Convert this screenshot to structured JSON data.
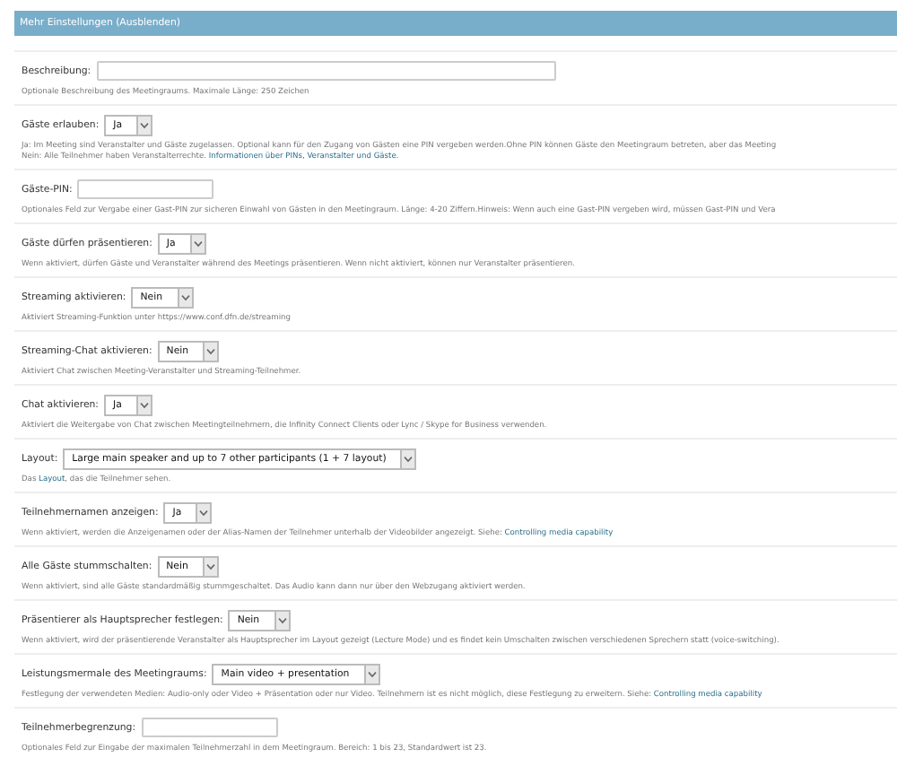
{
  "section_header": {
    "title": "Mehr Einstellungen (Ausblenden)"
  },
  "fields": [
    {
      "kind": "text_wide",
      "label": "Beschreibung:",
      "help": [
        [
          {
            "text": "Optionale Beschreibung des Meetingraums. Maximale Länge: 250 Zeichen"
          }
        ]
      ]
    },
    {
      "kind": "select",
      "label": "Gäste erlauben:",
      "value": "Ja",
      "help": [
        [
          {
            "text": "Ja: Im Meeting sind Veranstalter und Gäste zugelassen. Optional kann für den Zugang von Gästen eine PIN vergeben werden.Ohne PIN können Gäste den Meetingraum betreten, aber das Meeting"
          }
        ],
        [
          {
            "text": "Nein: Alle Teilnehmer haben Veranstalterrechte. "
          },
          {
            "text": "Informationen über PINs, Veranstalter und Gäste.",
            "kind": "link"
          }
        ]
      ]
    },
    {
      "kind": "text_short",
      "label": "Gäste-PIN:",
      "help": [
        [
          {
            "text": "Optionales Feld zur Vergabe einer Gast-PIN zur sicheren Einwahl von Gästen in den Meetingraum. Länge: 4-20 Ziffern.Hinweis: Wenn auch eine Gast-PIN vergeben wird, müssen Gast-PIN und Vera"
          }
        ]
      ]
    },
    {
      "kind": "select",
      "label": "Gäste dürfen präsentieren:",
      "value": "Ja",
      "help": [
        [
          {
            "text": "Wenn aktiviert, dürfen Gäste und Veranstalter während des Meetings präsentieren. Wenn nicht aktiviert, können nur Veranstalter präsentieren."
          }
        ]
      ]
    },
    {
      "kind": "select",
      "label": "Streaming aktivieren:",
      "value": "Nein",
      "help": [
        [
          {
            "text": "Aktiviert Streaming-Funktion unter https://www.conf.dfn.de/streaming"
          }
        ]
      ]
    },
    {
      "kind": "select",
      "label": "Streaming-Chat aktivieren:",
      "value": "Nein",
      "help": [
        [
          {
            "text": "Aktiviert Chat zwischen Meeting-Veranstalter und Streaming-Teilnehmer."
          }
        ]
      ]
    },
    {
      "kind": "select",
      "label": "Chat aktivieren:",
      "value": "Ja",
      "help": [
        [
          {
            "text": "Aktiviert die Weitergabe von Chat zwischen Meetingteilnehmern, die Infinity Connect Clients oder Lync / Skype for Business verwenden."
          }
        ]
      ]
    },
    {
      "kind": "select",
      "label": "Layout:",
      "value": "Large main speaker and up to 7 other participants (1 + 7 layout)",
      "help": [
        [
          {
            "text": "Das "
          },
          {
            "text": "Layout",
            "kind": "link"
          },
          {
            "text": ", das die Teilnehmer sehen."
          }
        ]
      ]
    },
    {
      "kind": "select",
      "label": "Teilnehmernamen anzeigen:",
      "value": "Ja",
      "help": [
        [
          {
            "text": "Wenn aktiviert, werden die Anzeigenamen oder der Alias-Namen der Teilnehmer unterhalb der Videobilder angezeigt. Siehe: "
          },
          {
            "text": "Controlling media capability",
            "kind": "link"
          }
        ]
      ]
    },
    {
      "kind": "select",
      "label": "Alle Gäste stummschalten:",
      "value": "Nein",
      "help": [
        [
          {
            "text": "Wenn aktiviert, sind alle Gäste standardmäßig stummgeschaltet. Das Audio kann dann nur über den Webzugang aktiviert werden."
          }
        ]
      ]
    },
    {
      "kind": "select",
      "label": "Präsentierer als Hauptsprecher festlegen:",
      "value": "Nein",
      "help": [
        [
          {
            "text": "Wenn aktiviert, wird der präsentierende Veranstalter als Hauptsprecher im Layout gezeigt (Lecture Mode) und es findet kein Umschalten zwischen verschiedenen Sprechern statt (voice-switching)."
          }
        ]
      ]
    },
    {
      "kind": "select",
      "label": "Leistungsmermale des Meetingraums:",
      "value": "Main video + presentation",
      "help": [
        [
          {
            "text": "Festlegung der verwendeten Medien: Audio-only oder Video + Präsentation oder nur Video. Teilnehmern ist es nicht möglich, diese Festlegung zu erweitern. Siehe: "
          },
          {
            "text": "Controlling media capability",
            "kind": "link"
          }
        ]
      ]
    },
    {
      "kind": "text_short",
      "label": "Teilnehmerbegrenzung:",
      "help": [
        [
          {
            "text": "Optionales Feld zur Eingabe der maximalen Teilnehmerzahl in dem Meetingraum. Bereich: 1 bis 23, Standardwert ist 23."
          }
        ]
      ]
    }
  ]
}
